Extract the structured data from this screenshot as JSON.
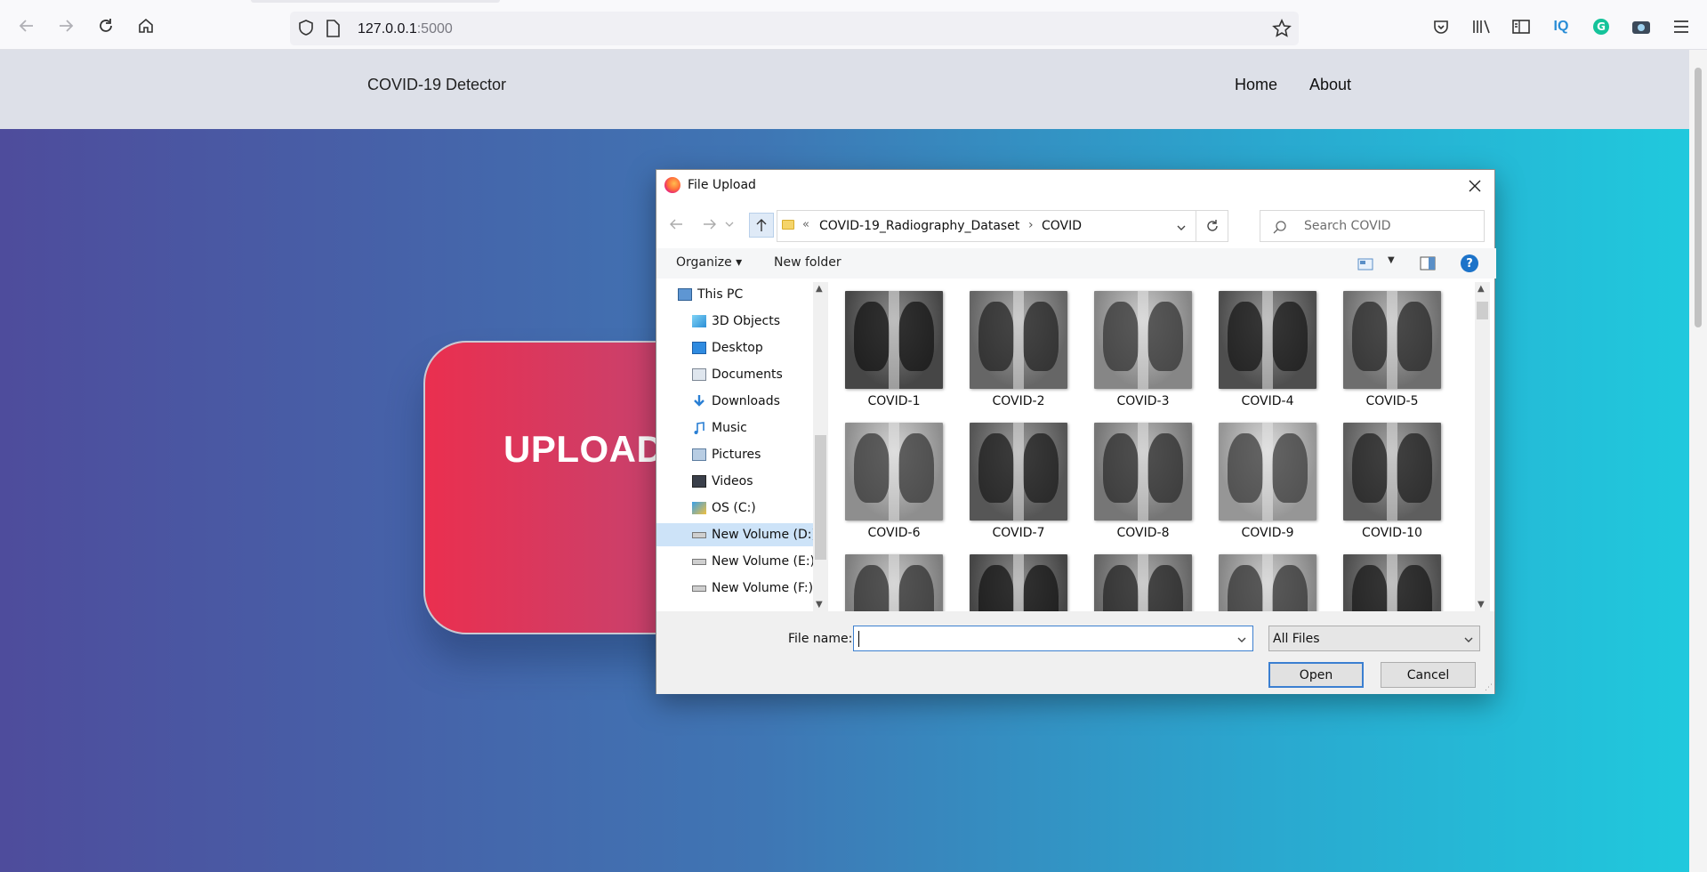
{
  "browser": {
    "url_host": "127.0.0.1",
    "url_port": ":5000"
  },
  "site": {
    "brand": "COVID-19 Detector",
    "nav": [
      "Home",
      "About"
    ],
    "upload_text": "UPLOAD"
  },
  "dialog": {
    "title": "File Upload",
    "breadcrumb": {
      "overflow": "«",
      "parent": "COVID-19_Radiography_Dataset",
      "current": "COVID",
      "separator": "›"
    },
    "search_placeholder": "Search COVID",
    "commands": {
      "organize": "Organize ▾",
      "new_folder": "New folder",
      "help": "?"
    },
    "tree": [
      {
        "label": "This PC",
        "icon": "computer-icon"
      },
      {
        "label": "3D Objects",
        "icon": "cube-icon"
      },
      {
        "label": "Desktop",
        "icon": "desktop-icon"
      },
      {
        "label": "Documents",
        "icon": "documents-icon"
      },
      {
        "label": "Downloads",
        "icon": "download-icon"
      },
      {
        "label": "Music",
        "icon": "music-icon"
      },
      {
        "label": "Pictures",
        "icon": "pictures-icon"
      },
      {
        "label": "Videos",
        "icon": "videos-icon"
      },
      {
        "label": "OS (C:)",
        "icon": "drive-os-icon"
      },
      {
        "label": "New Volume (D:)",
        "icon": "drive-icon"
      },
      {
        "label": "New Volume (E:)",
        "icon": "drive-icon"
      },
      {
        "label": "New Volume (F:)",
        "icon": "drive-icon"
      }
    ],
    "files": [
      "COVID-1",
      "COVID-2",
      "COVID-3",
      "COVID-4",
      "COVID-5",
      "COVID-6",
      "COVID-7",
      "COVID-8",
      "COVID-9",
      "COVID-10",
      "",
      "",
      "",
      "",
      ""
    ],
    "file_name_label": "File name:",
    "file_name_value": "",
    "file_type": "All Files",
    "open_label": "Open",
    "cancel_label": "Cancel"
  }
}
